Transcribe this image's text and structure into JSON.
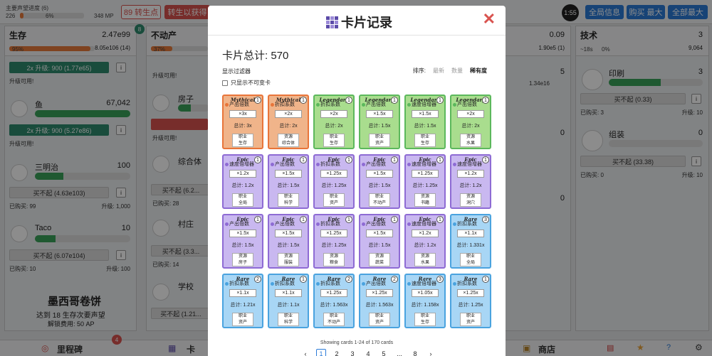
{
  "topbar": {
    "progress_label": "主要声望进度 (6)",
    "left_val": "226",
    "pct": "6%",
    "mp": "348 MP",
    "btn1": "89 转生点",
    "btn2": "转生以获得",
    "timer": "1:55",
    "btn_info": "全局信息",
    "btn_buy": "购买 最大",
    "btn_all": "全部最大"
  },
  "left": {
    "title": "生存",
    "value": "2.47e99",
    "pct": "95%",
    "sub": "8.05e106 (14)",
    "items": [
      {
        "upgrade": "2x 升级: 900 (1.77e65)",
        "status": "升级可用!"
      },
      {
        "name": "鱼",
        "count": "67,042",
        "rate": "0 秒",
        "rate2": "1.22e2",
        "upgrade": "2x 升级: 900 (5.27e86)",
        "status": "升级可用!"
      },
      {
        "name": "三明治",
        "count": "100",
        "rate": "1 秒",
        "rate2": "33,671",
        "buy": "买不起 (4.63e103)",
        "bought": "已购买: 99",
        "upgrade_label": "升级: 1,000"
      },
      {
        "name": "Taco",
        "count": "10",
        "rate": "2 秒",
        "buy": "买不起 (6.07e104)",
        "bought": "已购买: 10",
        "upgrade_label": "升级: 100"
      }
    ],
    "banner_title": "墨西哥卷饼",
    "banner_line1": "达到 18 生存次要声望",
    "banner_line2": "解锁费用: 50 AP"
  },
  "mid": {
    "title": "不动产",
    "badge": "8",
    "pct": "37%",
    "items": [
      {
        "status": "升级可用!"
      },
      {
        "name": "房子",
        "rate": "2 秒"
      },
      {
        "name": "综合体",
        "buy": "买不起 (6.2..."
      },
      {
        "name": "村庄",
        "buy": "买不起 (3.3..."
      },
      {
        "name": "学校",
        "buy": "买不起 (1.21..."
      }
    ],
    "bought1": "已购买: 28",
    "status2": "升级可用!",
    "bought2": "已购买: 14"
  },
  "right_partial": {
    "val1": "0.09",
    "sub1": "1.90e5 (1)",
    "v5": "5",
    "v0a": "0",
    "v0b": "0",
    "rate": "1.34e16"
  },
  "tech": {
    "title": "技术",
    "value": "3",
    "sub1": "~18s",
    "pct": "0%",
    "sub2": "9,064",
    "items": [
      {
        "name": "印刷",
        "count": "3",
        "rate": "1.7 秒",
        "rate2": "1.55e16",
        "buy": "买不起 (0.33)",
        "bought": "已购买: 3",
        "upgrade_label": "升级: 10"
      },
      {
        "name": "组装",
        "count": "0",
        "buy": "买不起 (33.38)",
        "bought": "已购买: 0",
        "upgrade_label": "升级: 10"
      }
    ]
  },
  "bottom": {
    "milestone": "里程碑",
    "milestone_badge": "4",
    "cards": "卡",
    "shop": "商店"
  },
  "modal": {
    "title": "卡片记录",
    "total": "卡片总计: 570",
    "filter": "显示过滤器",
    "checkbox": "只显示不可变卡",
    "sort_label": "排序:",
    "sort1": "最新",
    "sort2": "数量",
    "sort3": "稀有度",
    "showing": "Showing cards 1-24 of 170 cards",
    "pages": [
      "‹",
      "1",
      "2",
      "3",
      "4",
      "5",
      "...",
      "8",
      "›"
    ]
  },
  "cards": [
    {
      "rarity": "Mythical",
      "n": "1",
      "name": "产出倍数",
      "mult": "×3x",
      "total": "总计: 3x",
      "t1": "职业",
      "t2": "生存"
    },
    {
      "rarity": "Mythical",
      "n": "1",
      "name": "折扣系数",
      "mult": "×2x",
      "total": "总计: 2x",
      "t1": "资源",
      "t2": "综合体"
    },
    {
      "rarity": "Legendary",
      "n": "1",
      "name": "折扣系数",
      "mult": "×2x",
      "total": "总计: 2x",
      "t1": "职业",
      "t2": "生存"
    },
    {
      "rarity": "Legendary",
      "n": "1",
      "name": "产出倍数",
      "mult": "×1.5x",
      "total": "总计: 1.5x",
      "t1": "职业",
      "t2": "资产"
    },
    {
      "rarity": "Legendary",
      "n": "1",
      "name": "速度倍增器",
      "mult": "×1.5x",
      "total": "总计: 1.5x",
      "t1": "职业",
      "t2": "生存"
    },
    {
      "rarity": "Legendary",
      "n": "1",
      "name": "产出倍数",
      "mult": "×2x",
      "total": "总计: 2x",
      "t1": "资源",
      "t2": "水果"
    },
    {
      "rarity": "Epic",
      "n": "1",
      "name": "速度倍增器",
      "mult": "×1.2x",
      "total": "总计: 1.2x",
      "t1": "职业",
      "t2": "全局"
    },
    {
      "rarity": "Epic",
      "n": "1",
      "name": "产出倍数",
      "mult": "×1.5x",
      "total": "总计: 1.5x",
      "t1": "职业",
      "t2": "科学"
    },
    {
      "rarity": "Epic",
      "n": "1",
      "name": "折扣系数",
      "mult": "×1.25x",
      "total": "总计: 1.25x",
      "t1": "职业",
      "t2": "资产"
    },
    {
      "rarity": "Epic",
      "n": "1",
      "name": "产出倍数",
      "mult": "×1.5x",
      "total": "总计: 1.5x",
      "t1": "职业",
      "t2": "不动产"
    },
    {
      "rarity": "Epic",
      "n": "1",
      "name": "速度倍增器",
      "mult": "×1.25x",
      "total": "总计: 1.25x",
      "t1": "资源",
      "t2": "书籍"
    },
    {
      "rarity": "Epic",
      "n": "1",
      "name": "速度倍增器",
      "mult": "×1.2x",
      "total": "总计: 1.2x",
      "t1": "资源",
      "t2": "洞穴"
    },
    {
      "rarity": "Epic",
      "n": "1",
      "name": "产出倍数",
      "mult": "×1.5x",
      "total": "总计: 1.5x",
      "t1": "资源",
      "t2": "房子"
    },
    {
      "rarity": "Epic",
      "n": "1",
      "name": "产出倍数",
      "mult": "×1.5x",
      "total": "总计: 1.5x",
      "t1": "资源",
      "t2": "服装"
    },
    {
      "rarity": "Epic",
      "n": "1",
      "name": "折扣系数",
      "mult": "×1.25x",
      "total": "总计: 1.25x",
      "t1": "资源",
      "t2": "粮食"
    },
    {
      "rarity": "Epic",
      "n": "1",
      "name": "产出倍数",
      "mult": "×1.5x",
      "total": "总计: 1.5x",
      "t1": "资源",
      "t2": "蔬菜"
    },
    {
      "rarity": "Epic",
      "n": "1",
      "name": "速度倍增器",
      "mult": "×1.2x",
      "total": "总计: 1.2x",
      "t1": "资源",
      "t2": "水果"
    },
    {
      "rarity": "Rare",
      "n": "3",
      "name": "折扣系数",
      "mult": "×1.1x",
      "total": "总计: 1.331x",
      "t1": "职业",
      "t2": "全局"
    },
    {
      "rarity": "Rare",
      "n": "2",
      "name": "折扣系数",
      "mult": "×1.1x",
      "total": "总计: 1.21x",
      "t1": "职业",
      "t2": "资产"
    },
    {
      "rarity": "Rare",
      "n": "1",
      "name": "折扣系数",
      "mult": "×1.1x",
      "total": "总计: 1.1x",
      "t1": "职业",
      "t2": "科学"
    },
    {
      "rarity": "Rare",
      "n": "2",
      "name": "折扣系数",
      "mult": "×1.25x",
      "total": "总计: 1.563x",
      "t1": "职业",
      "t2": "不动产"
    },
    {
      "rarity": "Rare",
      "n": "2",
      "name": "产出倍数",
      "mult": "×1.25x",
      "total": "总计: 1.563x",
      "t1": "职业",
      "t2": "资产"
    },
    {
      "rarity": "Rare",
      "n": "3",
      "name": "速度倍增器",
      "mult": "×1.05x",
      "total": "总计: 1.158x",
      "t1": "职业",
      "t2": "生存"
    },
    {
      "rarity": "Rare",
      "n": "1",
      "name": "折扣系数",
      "mult": "×1.25x",
      "total": "总计: 1.25x",
      "t1": "职业",
      "t2": "资产"
    }
  ],
  "colors": {
    "Mythical": "#e8753a",
    "Legendary": "#5cb85c",
    "Epic": "#8e6bd4",
    "Rare": "#4aa3df"
  }
}
